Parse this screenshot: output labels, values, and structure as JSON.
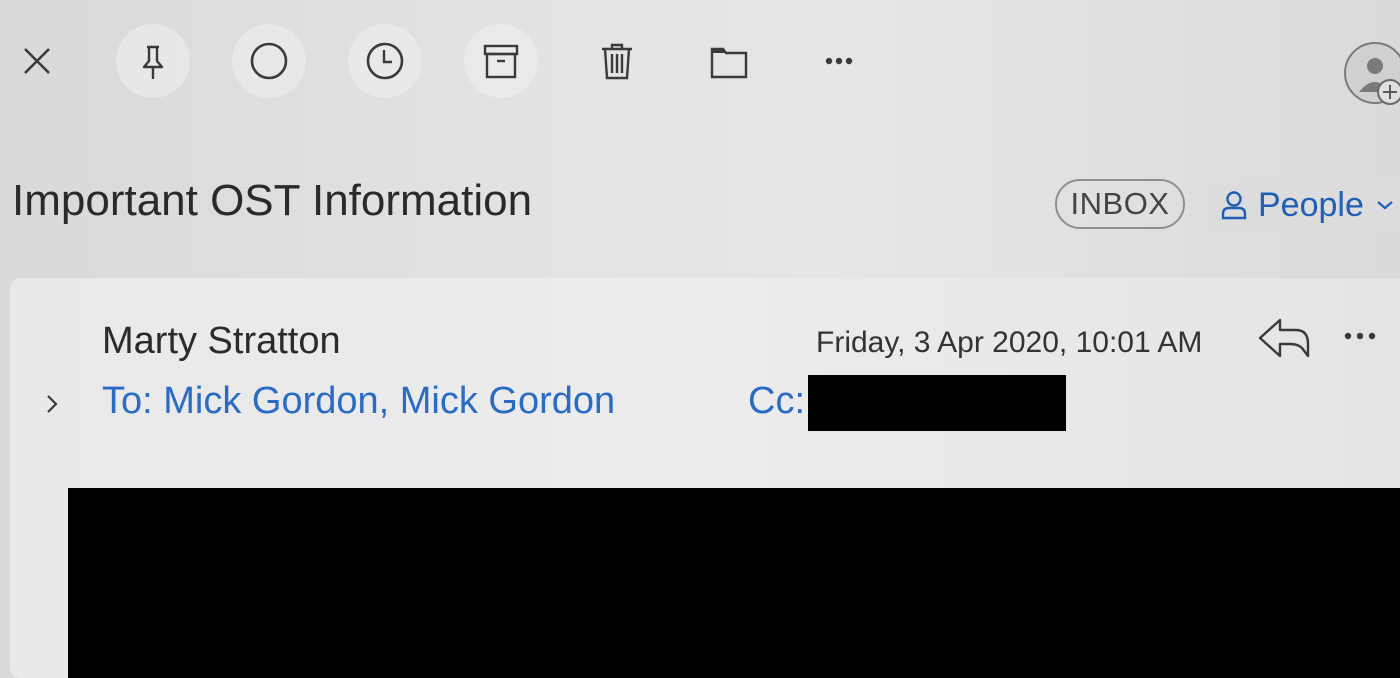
{
  "toolbar": {
    "buttons": [
      {
        "name": "close",
        "icon": "close-icon"
      },
      {
        "name": "pin",
        "icon": "pin-icon"
      },
      {
        "name": "mark-unread",
        "icon": "circle-icon"
      },
      {
        "name": "snooze",
        "icon": "clock-icon"
      },
      {
        "name": "archive",
        "icon": "archive-icon"
      },
      {
        "name": "delete",
        "icon": "trash-icon"
      },
      {
        "name": "move",
        "icon": "folder-icon"
      },
      {
        "name": "more",
        "icon": "more-icon"
      }
    ],
    "add_contact_icon": "person-add-icon"
  },
  "message": {
    "subject": "Important OST Information",
    "folder_badge": "INBOX",
    "people_button": "People",
    "sender": "Marty Stratton",
    "date": "Friday, 3 Apr 2020, 10:01 AM",
    "to": "To: Mick Gordon, Mick Gordon",
    "cc_label": "Cc:"
  },
  "colors": {
    "link_blue": "#2a6bc4",
    "people_blue": "#1f5fb5",
    "redaction": "#000000"
  }
}
